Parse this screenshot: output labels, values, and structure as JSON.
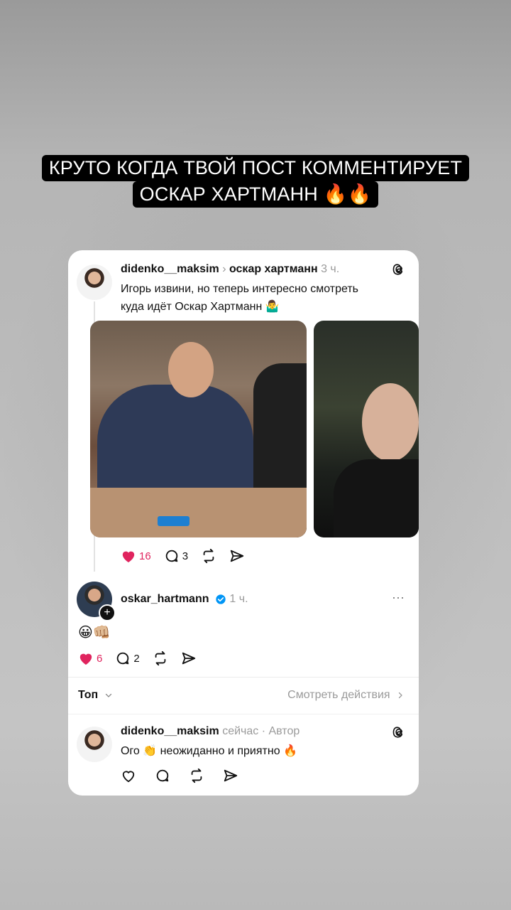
{
  "caption": {
    "line1": "КРУТО КОГДА ТВОЙ ПОСТ КОММЕНТИРУЕТ",
    "line2": "ОСКАР ХАРТМАНН 🔥🔥"
  },
  "post": {
    "author": "didenko__maksim",
    "reply_to": "оскар хартманн",
    "time": "3 ч.",
    "text_line1": "Игорь извини, но теперь интересно смотреть",
    "text_line2": "куда идёт Оскар Хартманн 🤷‍♂️",
    "likes": "16",
    "comments": "3"
  },
  "comment": {
    "author": "oskar_hartmann",
    "time": "1 ч.",
    "text": "😀👊🏼",
    "likes": "6",
    "comments": "2",
    "more": "···"
  },
  "sort": {
    "label": "Топ",
    "view_activity": "Смотреть действия"
  },
  "reply": {
    "author": "didenko__maksim",
    "meta": "сейчас · Автор",
    "text": "Ого 👏 неожиданно и приятно 🔥"
  },
  "colors": {
    "like_red": "#e0245e",
    "verified_blue": "#0095f6"
  }
}
